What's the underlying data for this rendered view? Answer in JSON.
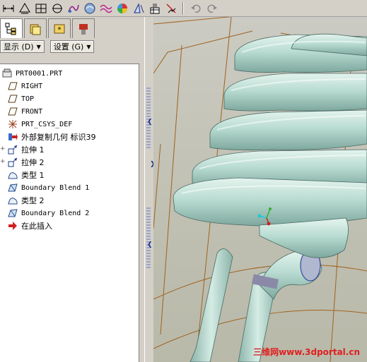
{
  "toolbar": {
    "icons": [
      "dimension-icon",
      "datum-plane-icon",
      "sketch-grid-icon",
      "datum-axis-icon",
      "curve-icon",
      "shading-icon",
      "wave-curve-icon",
      "color-sphere-icon",
      "measure-icon",
      "table-icon",
      "sweep-icon",
      "undo-icon",
      "redo-icon"
    ]
  },
  "panel": {
    "show_menu_label": "显示 (D)",
    "settings_menu_label": "设置 (G)"
  },
  "tree": {
    "root": "PRT0001.PRT",
    "items": [
      {
        "label": "RIGHT",
        "icon": "datum-plane-icon"
      },
      {
        "label": "TOP",
        "icon": "datum-plane-icon"
      },
      {
        "label": "FRONT",
        "icon": "datum-plane-icon"
      },
      {
        "label": "PRT_CSYS_DEF",
        "icon": "csys-icon"
      },
      {
        "label": "外部复制几何 标识39",
        "icon": "external-copy-icon"
      },
      {
        "label": "拉伸 1",
        "icon": "extrude-icon"
      },
      {
        "label": "拉伸 2",
        "icon": "extrude-icon"
      },
      {
        "label": "类型 1",
        "icon": "surface-icon"
      },
      {
        "label": "Boundary Blend 1",
        "icon": "boundary-blend-icon"
      },
      {
        "label": "类型 2",
        "icon": "surface-icon"
      },
      {
        "label": "Boundary Blend 2",
        "icon": "boundary-blend-icon"
      },
      {
        "label": "在此插入",
        "icon": "insert-here-arrow-icon"
      }
    ]
  },
  "watermark": {
    "text_cn": "三维网",
    "text_url": "www.3dportal.cn"
  },
  "colors": {
    "coil": "#b9dcd2",
    "coil_edge": "#4a6a64",
    "datum_line": "#a0621e",
    "background": "#c1c1b4"
  }
}
